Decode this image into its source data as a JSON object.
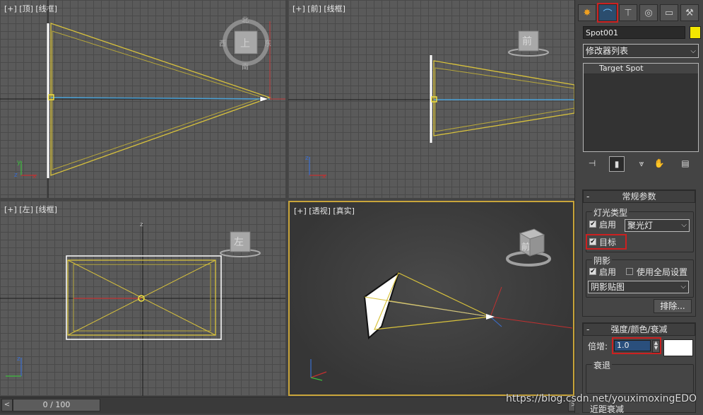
{
  "viewports": {
    "top": {
      "label": "[+] [顶] [线框]"
    },
    "front": {
      "label": "[+] [前] [线框]"
    },
    "left": {
      "label": "[+] [左] [线框]"
    },
    "perspective": {
      "label": "[+] [透视] [真实]"
    }
  },
  "viewcube": {
    "top_face": "上",
    "north": "北",
    "south": "南",
    "east": "东",
    "west": "西",
    "front_face": "前",
    "left_face": "左",
    "persp_face": "前"
  },
  "timeline": {
    "frame_readout": "0 / 100",
    "prev": "<",
    "next": ">"
  },
  "command_panel": {
    "tabs": [
      "create",
      "modify",
      "hierarchy",
      "motion",
      "display",
      "utilities"
    ],
    "object_name": "Spot001",
    "object_color": "#f2e600",
    "modifier_list": "修改器列表",
    "stack_items": [
      "Target Spot"
    ],
    "general_params": {
      "title": "常规参数",
      "light_type_group": "灯光类型",
      "enable_label": "启用",
      "light_type": "聚光灯",
      "target_label": "目标",
      "shadows_group": "阴影",
      "shadow_enable_label": "启用",
      "global_settings_label": "使用全局设置",
      "shadow_type": "阴影贴图",
      "exclude_button": "排除..."
    },
    "intensity": {
      "title": "强度/颜色/衰减",
      "multiplier_label": "倍增:",
      "multiplier_value": "1.0",
      "color_swatch": "#ffffff",
      "decay_group": "衰退",
      "near_atten": "近距衰减"
    }
  },
  "watermark": "https://blog.csdn.net/youximoxingEDO"
}
